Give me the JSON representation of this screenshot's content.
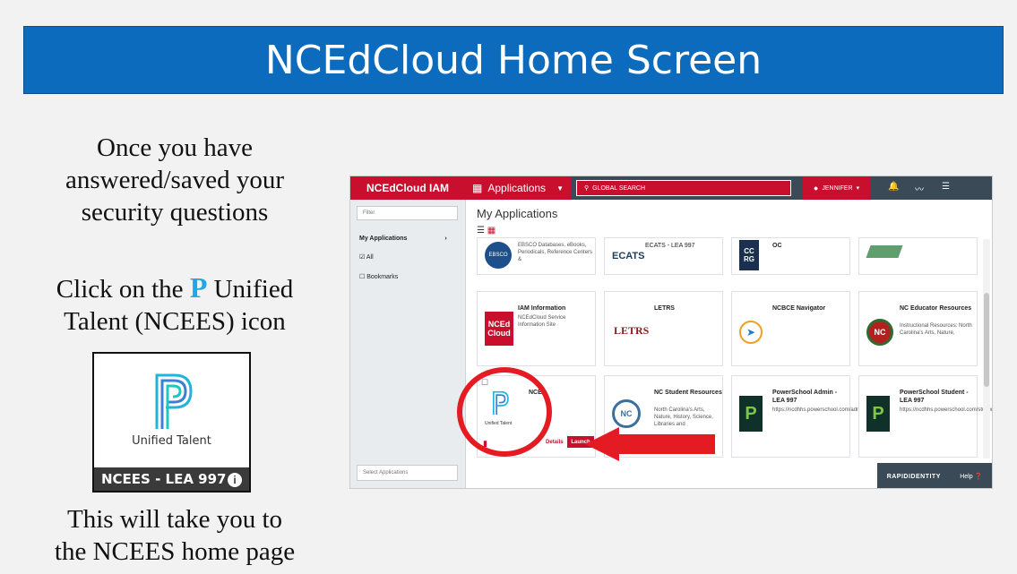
{
  "slide": {
    "title": "NCEdCloud Home Screen",
    "step1_line1": "Once you have",
    "step1_line2": "answered/saved your",
    "step1_line3": "security questions",
    "step2_prefix": "Click on the",
    "step2_p": "P",
    "step2_suffix": "Unified",
    "step2_line2": "Talent (NCEES) icon",
    "step3_line1": "This will take you to",
    "step3_line2": "the NCEES home page"
  },
  "ut_card": {
    "name": "Unified Talent",
    "caption": "NCEES - LEA 997",
    "info": "i"
  },
  "screenshot": {
    "logo": "NCEdCloud IAM",
    "apps_menu": "Applications",
    "search_placeholder": "GLOBAL SEARCH",
    "user": "JENNIFER",
    "sidebar": {
      "filter_placeholder": "Filter",
      "my_applications": "My Applications",
      "all": "All",
      "bookmarks": "Bookmarks",
      "select_applications": "Select Applications"
    },
    "main_title": "My Applications",
    "tiles": [
      {
        "name": "",
        "desc": "EBSCO Databases, eBooks, Periodicals, Reference Centers &",
        "icon_text": "EBSCO"
      },
      {
        "name": "ECATS - LEA 997",
        "desc": "",
        "icon_text": "ECATS"
      },
      {
        "name": "OC",
        "desc": "",
        "icon_text": "CC RG"
      },
      {
        "name": "",
        "desc": "",
        "icon_text": ""
      },
      {
        "name": "IAM Information",
        "desc": "NCEdCloud Service Information Site",
        "icon_text": "NCEd Cloud"
      },
      {
        "name": "LETRS",
        "desc": "",
        "icon_text": "LETRS"
      },
      {
        "name": "NCBCE Navigator",
        "desc": "",
        "icon_text": ""
      },
      {
        "name": "NC Educator Resources",
        "desc": "Instructional Resources: North Carolina's Arts, Nature,",
        "icon_text": "NC"
      },
      {
        "name": "NCE",
        "desc": "",
        "icon_text": "Unified Talent"
      },
      {
        "name": "NC Student Resources",
        "desc": "North Carolina's Arts, Nature, History, Science, Libraries and",
        "icon_text": "NC"
      },
      {
        "name": "PowerSchool Admin - LEA 997",
        "desc": "https://ncdhhs.powerschool.com/admin",
        "icon_text": ""
      },
      {
        "name": "PowerSchool Student - LEA 997",
        "desc": "https://ncdhhs.powerschool.com/student",
        "icon_text": ""
      }
    ],
    "details_link": "Details",
    "launch_button": "Launch",
    "rapid": "RAPIDIDENTITY",
    "help": "Help"
  },
  "colors": {
    "title_bg": "#0c6bbd",
    "accent_red": "#c8102e",
    "annotation_red": "#e41b23",
    "topbar_dark": "#3b4a57"
  }
}
